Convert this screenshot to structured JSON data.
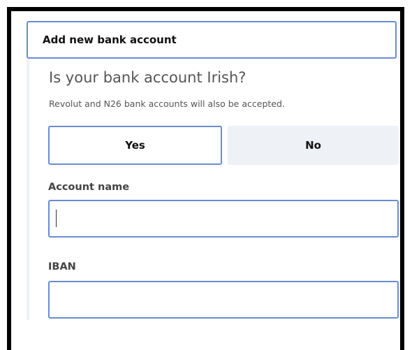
{
  "panel": {
    "title": "Add new bank account"
  },
  "question": {
    "text": "Is your bank account Irish?",
    "hint": "Revolut and N26 bank accounts will also be accepted."
  },
  "choices": {
    "yes_label": "Yes",
    "no_label": "No",
    "selected": "Yes"
  },
  "fields": {
    "account_name": {
      "label": "Account name",
      "value": "",
      "placeholder": ""
    },
    "iban": {
      "label": "IBAN",
      "value": "",
      "placeholder": ""
    }
  },
  "colors": {
    "accent_border": "#6a8bd4",
    "unselected_bg": "#eef1f6",
    "text_dark": "#111111",
    "text_muted": "#555555"
  }
}
